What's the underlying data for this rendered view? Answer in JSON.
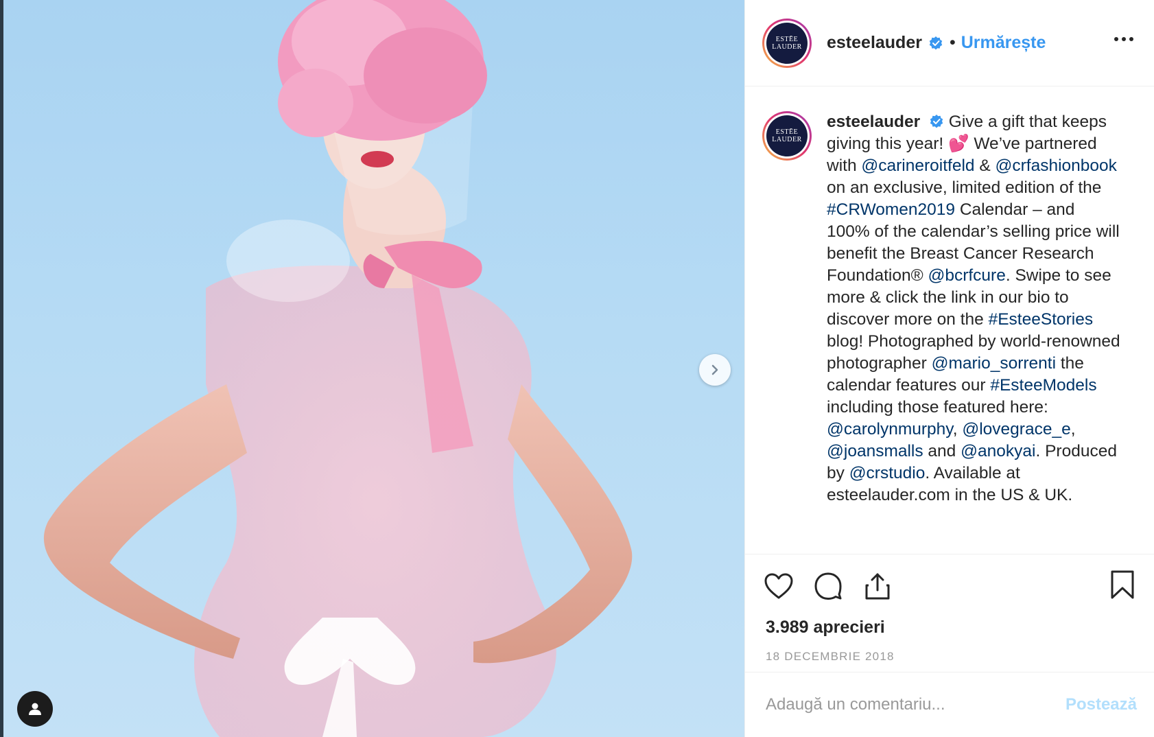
{
  "post": {
    "media": {
      "next_icon": "chevron-right-icon",
      "tag_icon": "user-tag-icon"
    },
    "header": {
      "username": "esteelauder",
      "verified_icon": "verified-badge-icon",
      "separator": "•",
      "follow_label": "Urmărește",
      "more_icon": "more-options-icon",
      "avatar_line1": "ESTĒE",
      "avatar_line2": "LAUDER"
    },
    "caption": {
      "username": "esteelauder",
      "text": [
        {
          "t": " Give a gift that keeps giving this year! 💕  We’ve partnered with "
        },
        {
          "t": "@carineroitfeld",
          "link": true
        },
        {
          "t": " & "
        },
        {
          "t": "@crfashionbook",
          "link": true
        },
        {
          "t": " on an exclusive, limited edition of the "
        },
        {
          "t": "#CRWomen2019",
          "link": true
        },
        {
          "t": " Calendar – and 100% of the calendar’s selling price will benefit the Breast Cancer Research Foundation® "
        },
        {
          "t": "@bcrfcure",
          "link": true
        },
        {
          "t": ". Swipe to see more & click the link in our bio to discover more on the "
        },
        {
          "t": "#EsteeStories",
          "link": true
        },
        {
          "t": " blog! Photographed by world-renowned photographer "
        },
        {
          "t": "@mario_sorrenti",
          "link": true
        },
        {
          "t": " the calendar features our "
        },
        {
          "t": "#EsteeModels",
          "link": true
        },
        {
          "t": " including those featured here: "
        },
        {
          "t": "@carolynmurphy",
          "link": true
        },
        {
          "t": ", "
        },
        {
          "t": "@lovegrace_e",
          "link": true
        },
        {
          "t": ", "
        },
        {
          "t": "@joansmalls",
          "link": true
        },
        {
          "t": " and "
        },
        {
          "t": "@anokyai",
          "link": true
        },
        {
          "t": ". Produced by "
        },
        {
          "t": "@crstudio",
          "link": true
        },
        {
          "t": ". Available at esteelauder.com in the US & UK."
        }
      ]
    },
    "actions": {
      "like_icon": "heart-icon",
      "comment_icon": "comment-icon",
      "share_icon": "share-icon",
      "save_icon": "bookmark-icon"
    },
    "likes_label": "3.989 aprecieri",
    "date_label": "18 DECEMBRIE 2018",
    "comment": {
      "placeholder": "Adaugă un comentariu...",
      "post_label": "Postează"
    }
  },
  "colors": {
    "link": "#003569",
    "follow": "#3897f0",
    "verified": "#3897f0",
    "post_disabled": "#b2dffc",
    "photo_background": "#b6dbf4"
  }
}
